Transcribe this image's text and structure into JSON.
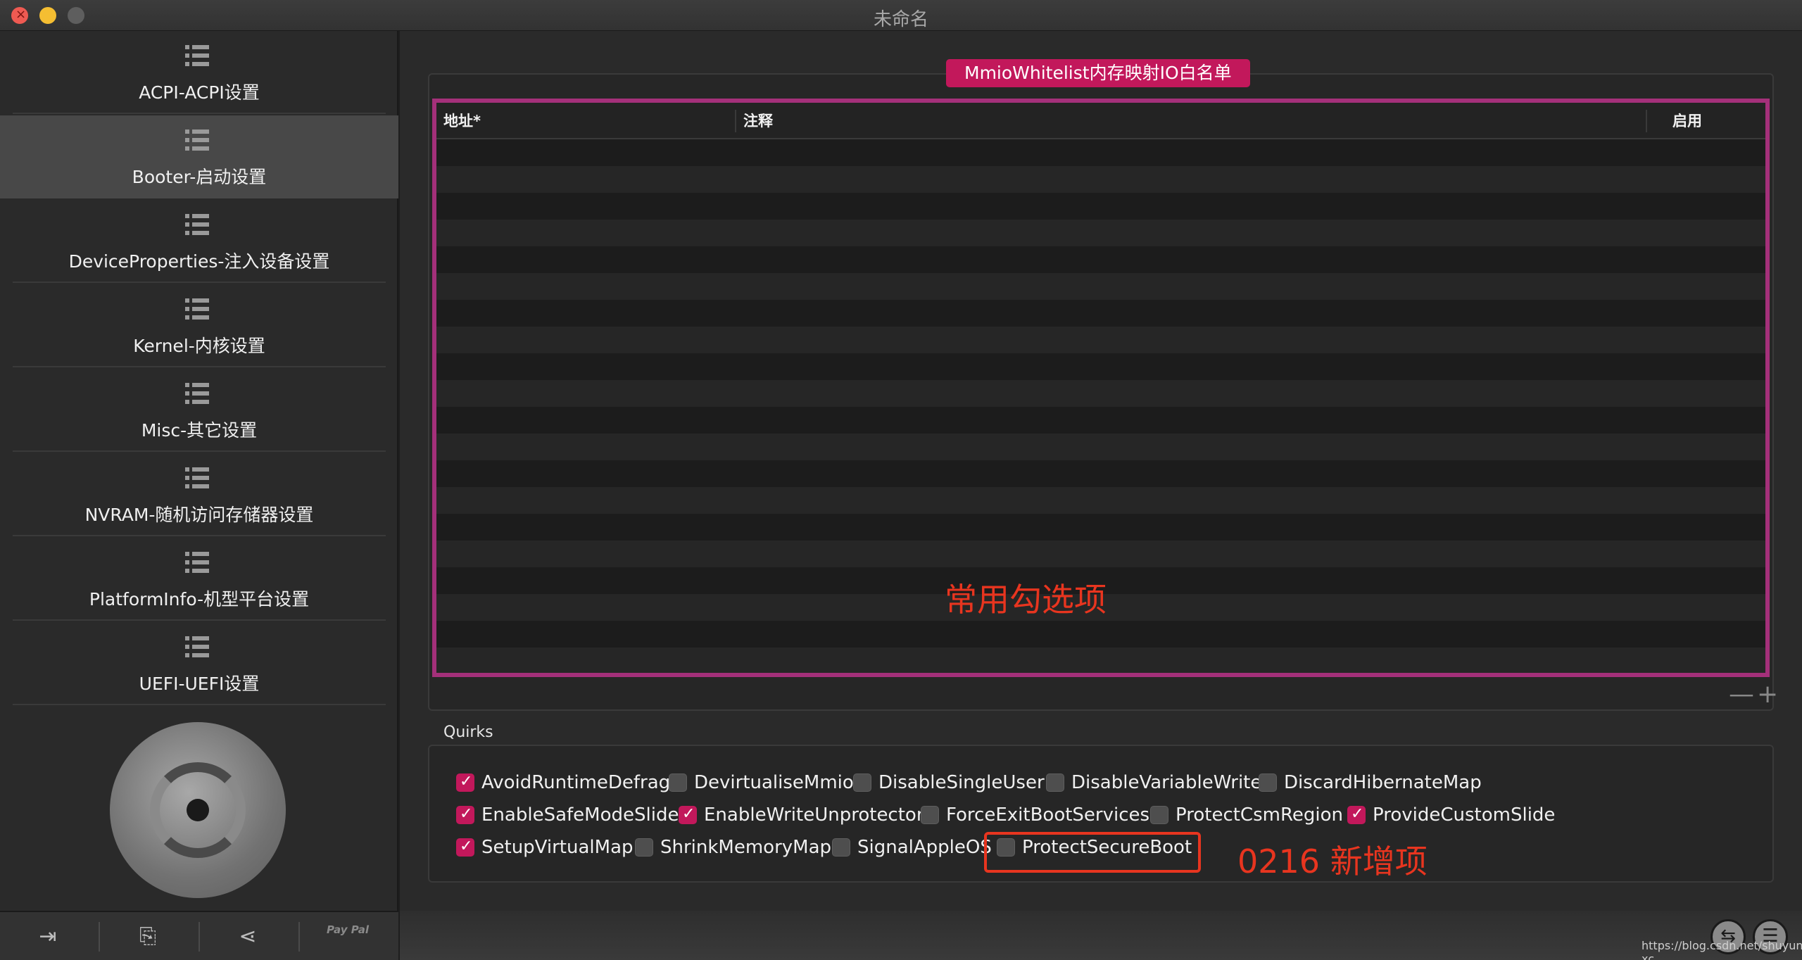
{
  "window": {
    "title": "未命名"
  },
  "sidebar": {
    "items": [
      {
        "label": "ACPI-ACPI设置",
        "active": false
      },
      {
        "label": "Booter-启动设置",
        "active": true
      },
      {
        "label": "DeviceProperties-注入设备设置",
        "active": false
      },
      {
        "label": "Kernel-内核设置",
        "active": false
      },
      {
        "label": "Misc-其它设置",
        "active": false
      },
      {
        "label": "NVRAM-随机访问存储器设置",
        "active": false
      },
      {
        "label": "PlatformInfo-机型平台设置",
        "active": false
      },
      {
        "label": "UEFI-UEFI设置",
        "active": false
      }
    ],
    "icon": "list-icon",
    "toolbar": {
      "import_icon": "import-icon",
      "export_icon": "export-icon",
      "share_icon": "share-icon",
      "paypal_label": "Pay Pal"
    }
  },
  "mmio": {
    "title": "MmioWhitelist内存映射IO白名单",
    "columns": {
      "address": "地址*",
      "comment": "注释",
      "enabled": "启用"
    },
    "add_label": "+",
    "remove_label": "—"
  },
  "quirks": {
    "title": "Quirks",
    "items": [
      {
        "label": "AvoidRuntimeDefrag",
        "checked": true
      },
      {
        "label": "DevirtualiseMmio",
        "checked": false
      },
      {
        "label": "DisableSingleUser",
        "checked": false
      },
      {
        "label": "DisableVariableWrite",
        "checked": false
      },
      {
        "label": "DiscardHibernateMap",
        "checked": false
      },
      {
        "label": "EnableSafeModeSlide",
        "checked": true
      },
      {
        "label": "EnableWriteUnprotector",
        "checked": true
      },
      {
        "label": "ForceExitBootServices",
        "checked": false
      },
      {
        "label": "ProtectCsmRegion",
        "checked": false
      },
      {
        "label": "ProvideCustomSlide",
        "checked": true
      },
      {
        "label": "SetupVirtualMap",
        "checked": true
      },
      {
        "label": "ShrinkMemoryMap",
        "checked": false
      },
      {
        "label": "SignalAppleOS",
        "checked": false
      },
      {
        "label": "ProtectSecureBoot",
        "checked": false
      }
    ]
  },
  "annotations": {
    "common": "常用勾选项",
    "new": "0216 新增项"
  },
  "watermark": "https://blog.csdn.net/shuyun xc",
  "colors": {
    "accent": "#c2185b",
    "table_border": "#a4307a",
    "annotation": "#e8351f"
  }
}
